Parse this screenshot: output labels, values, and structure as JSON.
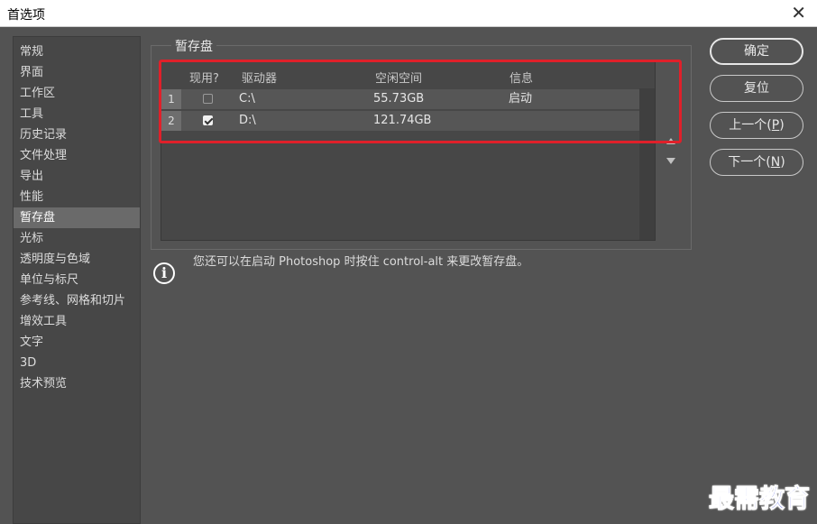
{
  "window": {
    "title": "首选项",
    "close_glyph": "✕"
  },
  "sidebar": {
    "items": [
      {
        "label": "常规"
      },
      {
        "label": "界面"
      },
      {
        "label": "工作区"
      },
      {
        "label": "工具"
      },
      {
        "label": "历史记录"
      },
      {
        "label": "文件处理"
      },
      {
        "label": "导出"
      },
      {
        "label": "性能"
      },
      {
        "label": "暂存盘",
        "selected": true
      },
      {
        "label": "光标"
      },
      {
        "label": "透明度与色域"
      },
      {
        "label": "单位与标尺"
      },
      {
        "label": "参考线、网格和切片"
      },
      {
        "label": "增效工具"
      },
      {
        "label": "文字"
      },
      {
        "label": "3D"
      },
      {
        "label": "技术预览"
      }
    ]
  },
  "scratch": {
    "legend": "暂存盘",
    "columns": {
      "active": "现用?",
      "drive": "驱动器",
      "free": "空闲空间",
      "info": "信息"
    },
    "rows": [
      {
        "num": "1",
        "checked": false,
        "drive": "C:\\",
        "free": "55.73GB",
        "info": "启动"
      },
      {
        "num": "2",
        "checked": true,
        "drive": "D:\\",
        "free": "121.74GB",
        "info": ""
      }
    ],
    "hint": "您还可以在启动 Photoshop 时按住 control-alt 来更改暂存盘。",
    "info_glyph": "i"
  },
  "buttons": {
    "ok": "确定",
    "reset": "复位",
    "prev": "上一个(",
    "prev_key": "P",
    "prev_end": ")",
    "next": "下一个(",
    "next_key": "N",
    "next_end": ")"
  },
  "watermark": "最需教育",
  "colors": {
    "highlight": "#e0202a",
    "watermark": "#1e2fd6"
  }
}
